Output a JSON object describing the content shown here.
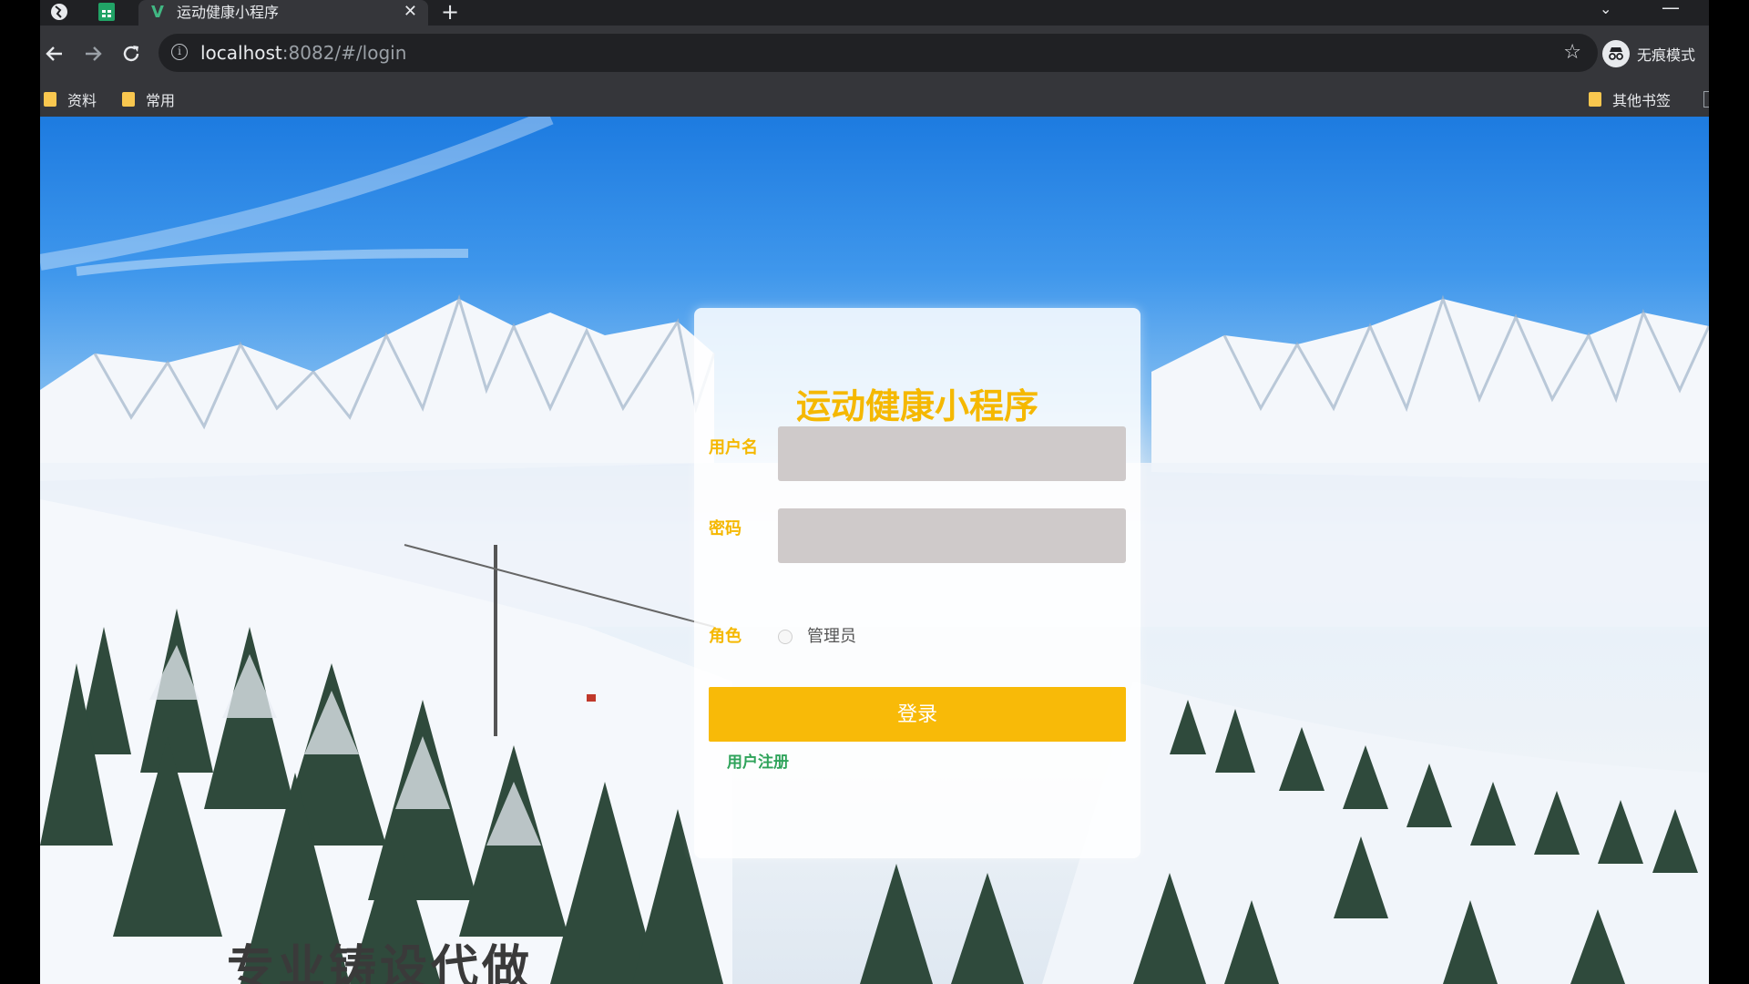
{
  "browser": {
    "tab": {
      "title": "运动健康小程序",
      "favicon": "V",
      "close": "✕"
    },
    "new_tab": "+",
    "tab_dropdown": "⌄",
    "minimize": "—",
    "url_host": "localhost",
    "url_rest": ":8082/#/login",
    "profile_label": "无痕模式",
    "bookmarks": [
      {
        "label": "资料"
      },
      {
        "label": "常用"
      }
    ],
    "other_bookmarks": "其他书签"
  },
  "login": {
    "title": "运动健康小程序",
    "username_label": "用户名",
    "password_label": "密码",
    "role_label": "角色",
    "role_value": "管理员",
    "login_button": "登录",
    "register_link": "用户注册"
  },
  "background_caption": "专业铸设代做",
  "colors": {
    "accent": "#f8ba08",
    "title": "#f5b800",
    "link": "#2ea35a"
  }
}
